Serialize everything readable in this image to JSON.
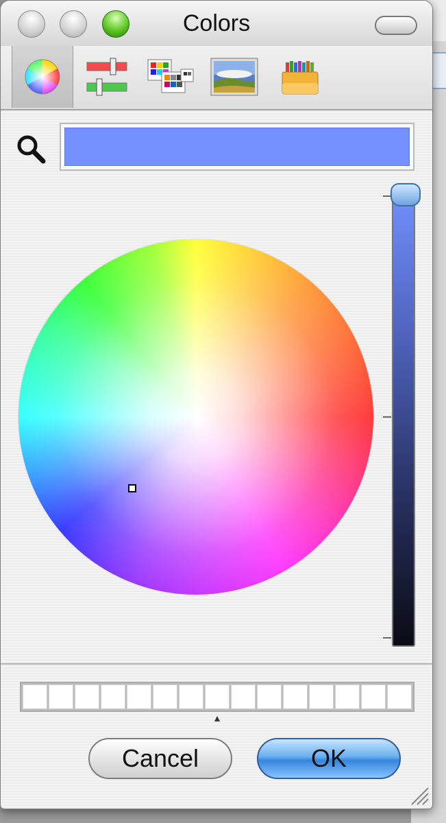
{
  "window": {
    "title": "Colors"
  },
  "modes": [
    {
      "name": "Color Wheel",
      "icon": "color-wheel-icon",
      "selected": true
    },
    {
      "name": "Color Sliders",
      "icon": "color-sliders-icon",
      "selected": false
    },
    {
      "name": "Color Palettes",
      "icon": "color-palettes-icon",
      "selected": false
    },
    {
      "name": "Image Palettes",
      "icon": "image-palettes-icon",
      "selected": false
    },
    {
      "name": "Crayons",
      "icon": "crayons-icon",
      "selected": false
    }
  ],
  "current_color": "#7391ff",
  "wheel_cursor_color": "#7391ff",
  "brightness_level": 1.0,
  "swatches": [
    "#ffffff",
    "#ffffff",
    "#ffffff",
    "#ffffff",
    "#ffffff",
    "#ffffff",
    "#ffffff",
    "#ffffff",
    "#ffffff",
    "#ffffff",
    "#ffffff",
    "#ffffff",
    "#ffffff",
    "#ffffff",
    "#ffffff"
  ],
  "buttons": {
    "cancel": "Cancel",
    "ok": "OK"
  }
}
